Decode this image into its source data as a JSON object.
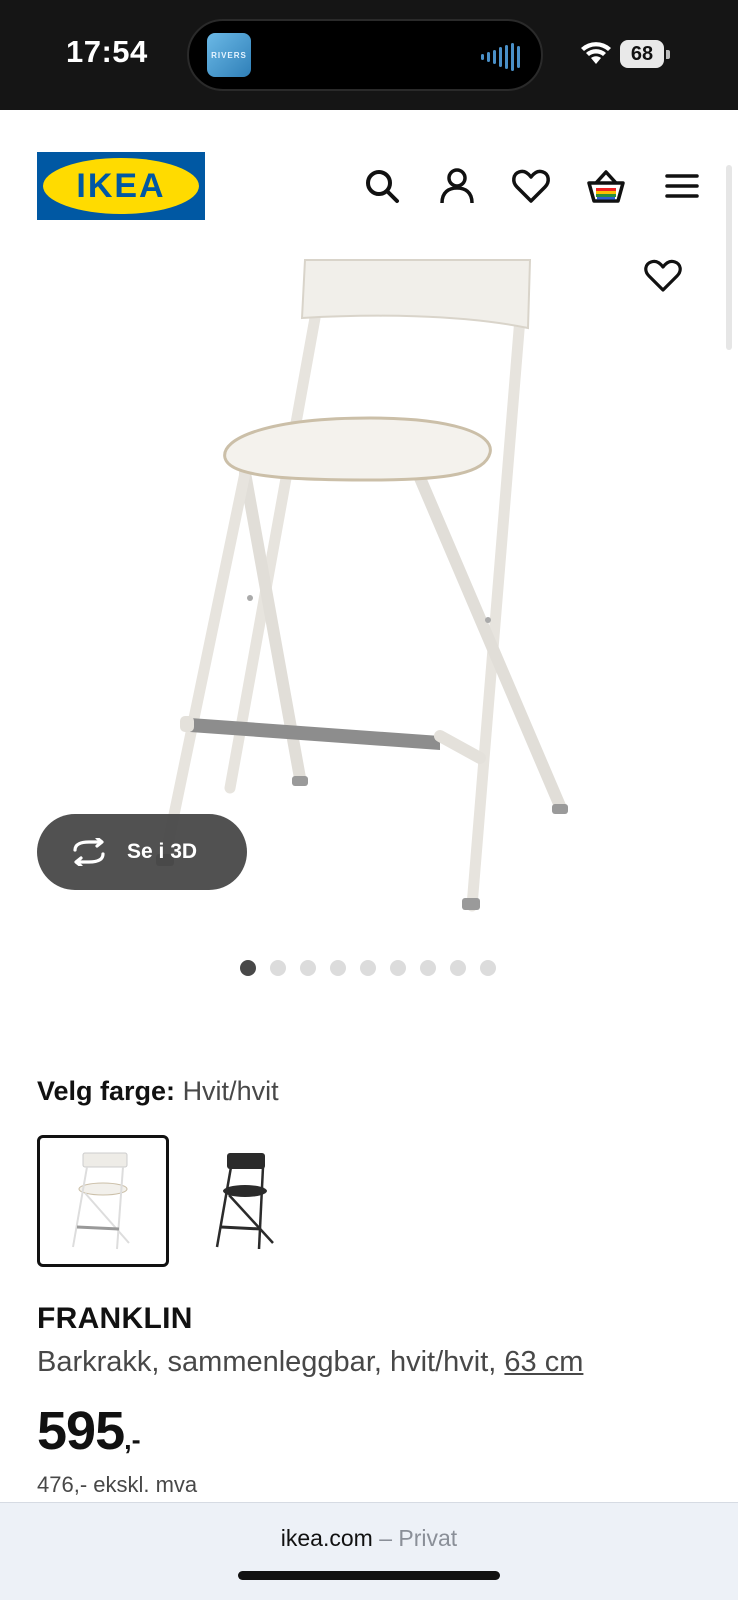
{
  "status_bar": {
    "time": "17:54",
    "now_playing_art_text": "RIVERS",
    "battery": "68"
  },
  "header": {
    "logo_text": "IKEA",
    "icons": [
      "search-icon",
      "account-icon",
      "favourites-icon",
      "basket-icon",
      "menu-icon"
    ]
  },
  "gallery": {
    "view_3d_label": "Se i 3D",
    "image_count": 9,
    "active_index": 0
  },
  "color": {
    "label": "Velg farge:",
    "value": "Hvit/hvit",
    "options": [
      "white",
      "black"
    ],
    "selected": "white"
  },
  "product": {
    "name": "FRANKLIN",
    "description": "Barkrakk, sammenleggbar, hvit/hvit, ",
    "size_link": "63 cm",
    "price": "595",
    "price_suffix": ",-",
    "ex_vat": "476,- ekskl. mva"
  },
  "browser": {
    "domain": "ikea.com",
    "separator": " – ",
    "mode": "Privat"
  },
  "colors": {
    "ikea_blue": "#0058a3",
    "ikea_yellow": "#ffdb00",
    "status_bar": "#151515"
  }
}
